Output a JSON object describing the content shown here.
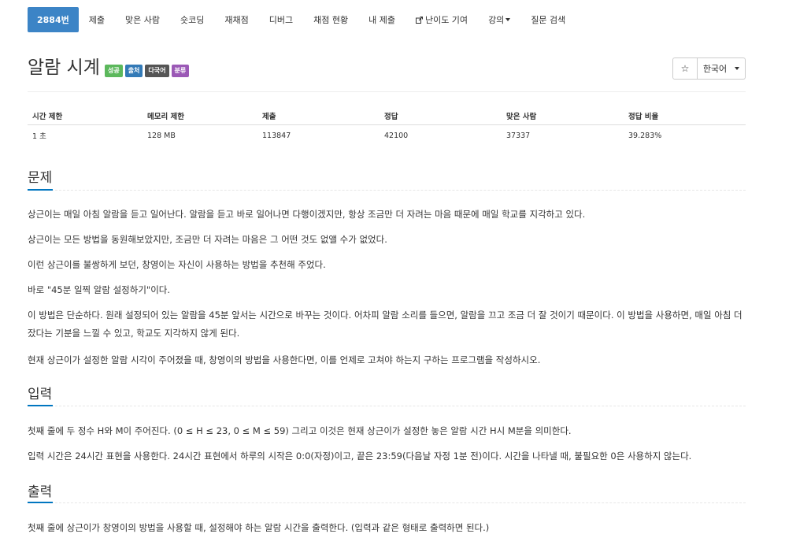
{
  "nav": {
    "problem_no": "2884번",
    "submit": "제출",
    "solved_users": "맞은 사람",
    "short_coding": "숏코딩",
    "rejudge": "재채점",
    "debug": "디버그",
    "judge_status": "채점 현황",
    "my_submissions": "내 제출",
    "difficulty_contrib": "난이도 기여",
    "lecture": "강의",
    "question_search": "질문 검색"
  },
  "problem": {
    "title": "알람 시계",
    "labels": [
      {
        "text": "성공",
        "color": "#5cb85c"
      },
      {
        "text": "출처",
        "color": "#337ab7"
      },
      {
        "text": "다국어",
        "color": "#555555"
      },
      {
        "text": "분류",
        "color": "#9b59b6"
      }
    ]
  },
  "toolbar": {
    "star": "☆",
    "language": "한국어"
  },
  "info": {
    "headers": [
      "시간 제한",
      "메모리 제한",
      "제출",
      "정답",
      "맞은 사람",
      "정답 비율"
    ],
    "values": [
      "1 초",
      "128 MB",
      "113847",
      "42100",
      "37337",
      "39.283%"
    ]
  },
  "sections": {
    "description": {
      "heading": "문제",
      "paragraphs": [
        "상근이는 매일 아침 알람을 듣고 일어난다. 알람을 듣고 바로 일어나면 다행이겠지만, 항상 조금만 더 자려는 마음 때문에 매일 학교를 지각하고 있다.",
        "상근이는 모든 방법을 동원해보았지만, 조금만 더 자려는 마음은 그 어떤 것도 없앨 수가 없었다.",
        "이런 상근이를 불쌍하게 보던, 창영이는 자신이 사용하는 방법을 추천해 주었다.",
        "바로 \"45분 일찍 알람 설정하기\"이다.",
        "이 방법은 단순하다. 원래 설정되어 있는 알람을 45분 앞서는 시간으로 바꾸는 것이다. 어차피 알람 소리를 들으면, 알람을 끄고 조금 더 잘 것이기 때문이다. 이 방법을 사용하면, 매일 아침 더 잤다는 기분을 느낄 수 있고, 학교도 지각하지 않게 된다.",
        "현재 상근이가 설정한 알람 시각이 주어졌을 때, 창영이의 방법을 사용한다면, 이를 언제로 고쳐야 하는지 구하는 프로그램을 작성하시오."
      ]
    },
    "input": {
      "heading": "입력",
      "paragraphs": [
        "첫째 줄에 두 정수 H와 M이 주어진다. (0 ≤ H ≤ 23, 0 ≤ M ≤ 59) 그리고 이것은 현재 상근이가 설정한 놓은 알람 시간 H시 M분을 의미한다.",
        "입력 시간은 24시간 표현을 사용한다. 24시간 표현에서 하루의 시작은 0:0(자정)이고, 끝은 23:59(다음날 자정 1분 전)이다. 시간을 나타낼 때, 불필요한 0은 사용하지 않는다."
      ]
    },
    "output": {
      "heading": "출력",
      "paragraphs": [
        "첫째 줄에 상근이가 창영이의 방법을 사용할 때, 설정해야 하는 알람 시간을 출력한다. (입력과 같은 형태로 출력하면 된다.)"
      ]
    }
  }
}
